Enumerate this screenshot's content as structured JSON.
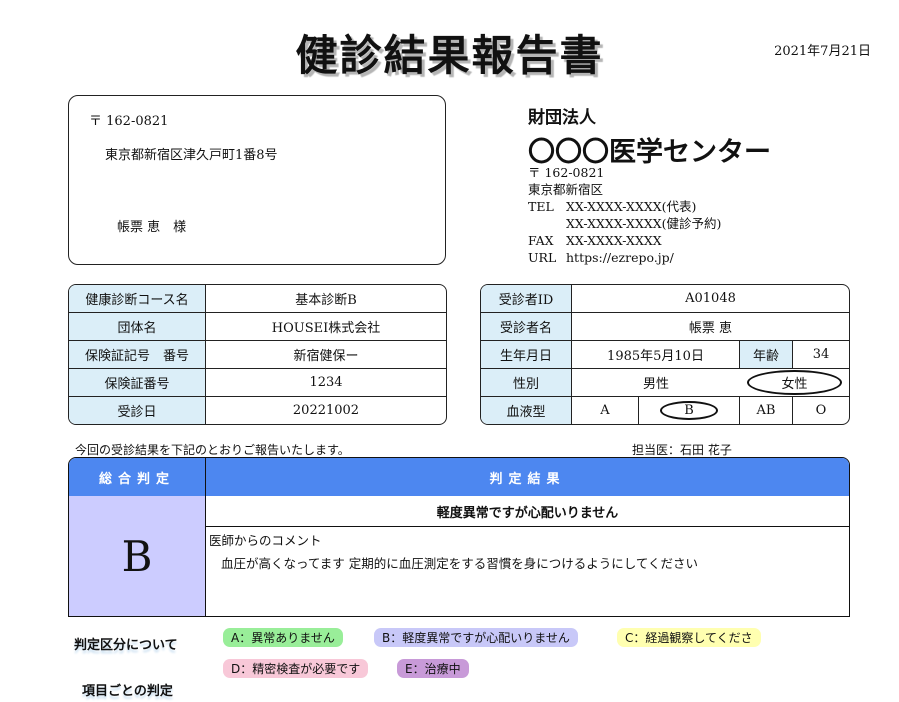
{
  "header": {
    "title": "健診結果報告書",
    "date": "2021年7月21日"
  },
  "recipient": {
    "zip": "〒 162-0821",
    "address": "東京都新宿区津久戸町1番8号",
    "name": "帳票 恵　様"
  },
  "organization": {
    "type": "財団法人",
    "name": "〇〇〇医学センター",
    "zip": "〒 162-0821",
    "address": "東京都新宿区",
    "tel_label": "TEL",
    "tel_main": "XX-XXXX-XXXX(代表)",
    "tel_reserve": "XX-XXXX-XXXX(健診予約)",
    "fax_label": "FAX",
    "fax": "XX-XXXX-XXXX",
    "url_label": "URL",
    "url": "https://ezrepo.jp/"
  },
  "course_table": {
    "course_label": "健康診断コース名",
    "course_value": "基本診断B",
    "group_label": "団体名",
    "group_value": "HOUSEI株式会社",
    "insurance_label": "保険証記号　番号",
    "insurance_value": "新宿健保ー",
    "insurance_no_label": "保険証番号",
    "insurance_no_value": "1234",
    "visit_label": "受診日",
    "visit_value": "20221002"
  },
  "patient_table": {
    "id_label": "受診者ID",
    "id_value": "A01048",
    "name_label": "受診者名",
    "name_value": "帳票 恵",
    "dob_label": "生年月日",
    "dob_value": "1985年5月10日",
    "age_label": "年齢",
    "age_value": "34",
    "sex_label": "性別",
    "sex_male": "男性",
    "sex_female": "女性",
    "blood_label": "血液型",
    "blood_a": "A",
    "blood_b": "B",
    "blood_ab": "AB",
    "blood_o": "O"
  },
  "intro_text": "今回の受診結果を下記のとおりご報告いたします。",
  "doctor": "担当医：石田 花子",
  "result": {
    "overall_header": "総合判定",
    "result_header": "判定結果",
    "grade": "B",
    "summary": "軽度異常ですが心配いりません",
    "comment_label": "医師からのコメント",
    "comment": "血圧が高くなってます 定期的に血圧測定をする習慣を身につけるようにしてください"
  },
  "legend": {
    "section_title": "判定区分について",
    "items": [
      {
        "text": "A：異常ありません",
        "color": "#99ee99"
      },
      {
        "text": "B：軽度異常ですが心配いりません",
        "color": "#c8c8f8"
      },
      {
        "text": "C：経過観察してくださ",
        "color": "#ffffb0"
      },
      {
        "text": "D：精密検査が必要です",
        "color": "#f8c8d8"
      },
      {
        "text": "E：治療中",
        "color": "#c89ad8"
      }
    ]
  },
  "items_section_title": "項目ごとの判定"
}
